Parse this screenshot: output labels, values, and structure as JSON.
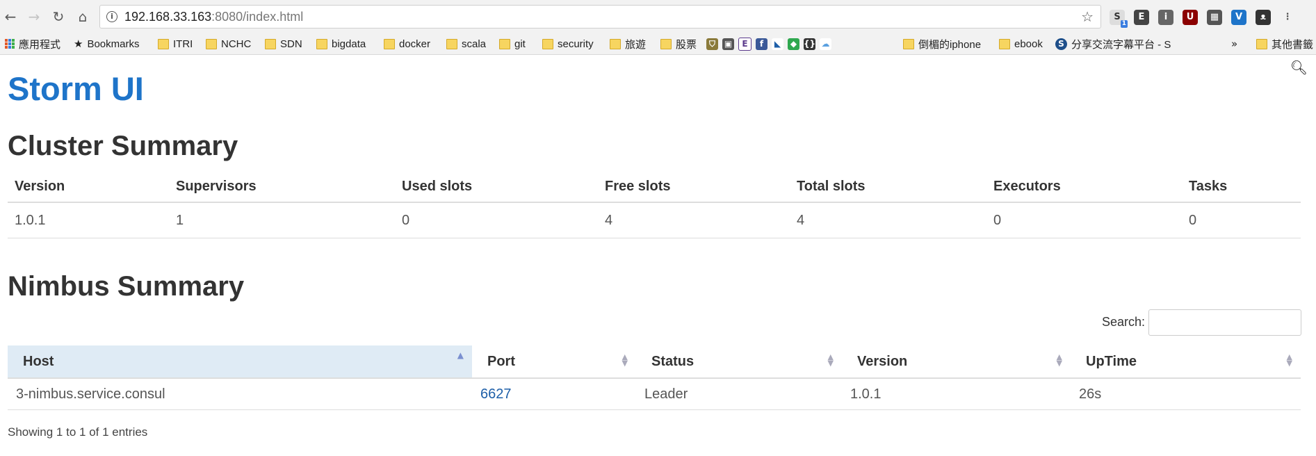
{
  "browser": {
    "url_host": "192.168.33.163",
    "url_rest": ":8080/index.html",
    "extension_badge": "1"
  },
  "bookmarks": {
    "apps": "應用程式",
    "items": [
      "Bookmarks",
      "ITRI",
      "NCHC",
      "SDN",
      "bigdata",
      "docker",
      "scala",
      "git",
      "security",
      "旅遊",
      "股票",
      "倒楣的iphone",
      "ebook",
      "分享交流字幕平台 - S",
      "其他書籤"
    ]
  },
  "page": {
    "title": "Storm UI"
  },
  "cluster_summary": {
    "heading": "Cluster Summary",
    "columns": [
      "Version",
      "Supervisors",
      "Used slots",
      "Free slots",
      "Total slots",
      "Executors",
      "Tasks"
    ],
    "row": [
      "1.0.1",
      "1",
      "0",
      "4",
      "4",
      "0",
      "0"
    ]
  },
  "nimbus_summary": {
    "heading": "Nimbus Summary",
    "search_label": "Search:",
    "search_value": "",
    "columns": [
      "Host",
      "Port",
      "Status",
      "Version",
      "UpTime"
    ],
    "row": {
      "host": "3-nimbus.service.consul",
      "port": "6627",
      "status": "Leader",
      "version": "1.0.1",
      "uptime": "26s"
    },
    "info": "Showing 1 to 1 of 1 entries"
  }
}
